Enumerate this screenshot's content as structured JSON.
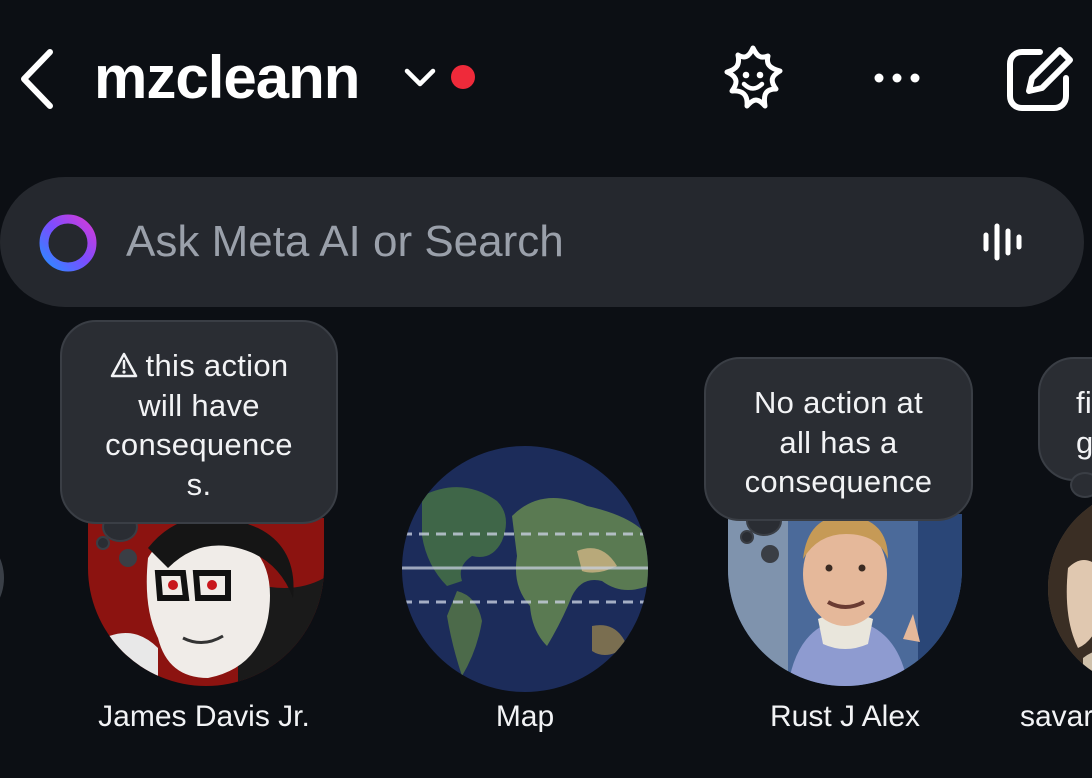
{
  "header": {
    "title": "mzcleann",
    "status_color": "#ef2a3a"
  },
  "search": {
    "placeholder": "Ask Meta AI or Search"
  },
  "notes": [
    {
      "name": "James Davis Jr.",
      "note_lines": [
        "this action",
        "will have",
        "consequence",
        "s."
      ],
      "note_icon": "warning-triangle-icon"
    },
    {
      "name": "Map"
    },
    {
      "name": "Rust J Alex",
      "note_lines": [
        "No action at",
        "all has a",
        "consequence"
      ]
    },
    {
      "name": "savar",
      "note_lines": [
        "fi",
        "ga"
      ]
    }
  ],
  "icons": {
    "back": "chevron-left-icon",
    "account_switch": "chevron-down-icon",
    "ai": "smiley-sparkle-icon",
    "more": "more-horizontal-icon",
    "compose": "compose-icon",
    "search_leading": "meta-ai-ring-icon",
    "voice": "voice-waveform-icon"
  }
}
